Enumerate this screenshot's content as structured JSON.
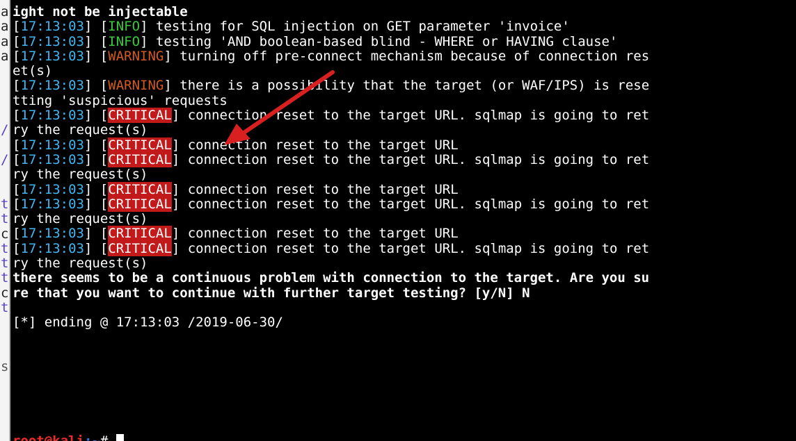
{
  "background_window": {
    "edge_chars": [
      "a",
      "a",
      "a",
      "a",
      "",
      "",
      "",
      "",
      "/",
      "",
      "/",
      "",
      "",
      "t",
      "t",
      "c",
      "t",
      "t",
      "t",
      "c",
      "t",
      "",
      "",
      "",
      "s",
      ""
    ]
  },
  "terminal": {
    "lines": [
      {
        "kind": "bold",
        "text": "ight not be injectable"
      },
      {
        "kind": "log",
        "ts": "17:13:03",
        "level": "INFO",
        "level_class": "info",
        "message": " testing for SQL injection on GET parameter 'invoice'"
      },
      {
        "kind": "log",
        "ts": "17:13:03",
        "level": "INFO",
        "level_class": "info",
        "message": " testing 'AND boolean-based blind - WHERE or HAVING clause'"
      },
      {
        "kind": "log",
        "ts": "17:13:03",
        "level": "WARNING",
        "level_class": "warn",
        "message": " turning off pre-connect mechanism because of connection res"
      },
      {
        "kind": "plain",
        "text": "et(s)"
      },
      {
        "kind": "log",
        "ts": "17:13:03",
        "level": "WARNING",
        "level_class": "warn",
        "message": " there is a possibility that the target (or WAF/IPS) is rese"
      },
      {
        "kind": "plain",
        "text": "tting 'suspicious' requests"
      },
      {
        "kind": "log",
        "ts": "17:13:03",
        "level": "CRITICAL",
        "level_class": "crit",
        "message": " connection reset to the target URL. sqlmap is going to ret"
      },
      {
        "kind": "plain",
        "text": "ry the request(s)"
      },
      {
        "kind": "log",
        "ts": "17:13:03",
        "level": "CRITICAL",
        "level_class": "crit",
        "message": " connection reset to the target URL"
      },
      {
        "kind": "log",
        "ts": "17:13:03",
        "level": "CRITICAL",
        "level_class": "crit",
        "message": " connection reset to the target URL. sqlmap is going to ret"
      },
      {
        "kind": "plain",
        "text": "ry the request(s)"
      },
      {
        "kind": "log",
        "ts": "17:13:03",
        "level": "CRITICAL",
        "level_class": "crit",
        "message": " connection reset to the target URL"
      },
      {
        "kind": "log",
        "ts": "17:13:03",
        "level": "CRITICAL",
        "level_class": "crit",
        "message": " connection reset to the target URL. sqlmap is going to ret"
      },
      {
        "kind": "plain",
        "text": "ry the request(s)"
      },
      {
        "kind": "log",
        "ts": "17:13:03",
        "level": "CRITICAL",
        "level_class": "crit",
        "message": " connection reset to the target URL"
      },
      {
        "kind": "log",
        "ts": "17:13:03",
        "level": "CRITICAL",
        "level_class": "crit",
        "message": " connection reset to the target URL. sqlmap is going to ret"
      },
      {
        "kind": "plain",
        "text": "ry the request(s)"
      },
      {
        "kind": "bold",
        "text": "there seems to be a continuous problem with connection to the target. Are you su"
      },
      {
        "kind": "bold",
        "text": "re that you want to continue with further target testing? [y/N] N"
      },
      {
        "kind": "blank",
        "text": ""
      },
      {
        "kind": "plain",
        "text": "[*] ending @ 17:13:03 /2019-06-30/"
      },
      {
        "kind": "blank",
        "text": ""
      },
      {
        "kind": "blank",
        "text": ""
      }
    ],
    "prompt": {
      "user_host": "root@kali",
      "path": ":~",
      "symbol": "# "
    }
  },
  "colors": {
    "timestamp": "#3fb6f2",
    "info": "#39c93b",
    "warning": "#d35a1f",
    "critical_bg": "#c21a1a",
    "annotation_arrow": "#d92020"
  },
  "icons": {
    "annotation": "red-arrow-icon"
  }
}
